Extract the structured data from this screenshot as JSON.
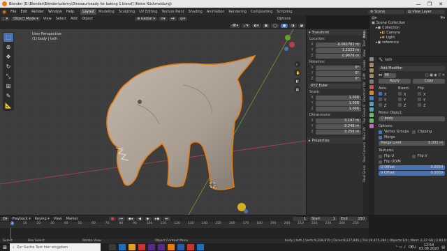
{
  "window": {
    "title": "Blender [E:\\Blender\\Blender\\udemy\\Dinosaur\\ready for baking 1.blend] (Keine Rückmeldung)",
    "controls": [
      "—",
      "❐",
      "✕"
    ]
  },
  "menubar": {
    "menus": [
      "File",
      "Edit",
      "Render",
      "Window",
      "Help"
    ],
    "workspaces": [
      "Layout",
      "Modeling",
      "Sculpting",
      "UV Editing",
      "Texture Paint",
      "Shading",
      "Animation",
      "Rendering",
      "Compositing",
      "Scripting"
    ],
    "active_workspace": "Layout",
    "scene_label": "Scene",
    "view_layer_label": "View Layer"
  },
  "viewport_header": {
    "mode": "Object Mode",
    "menus": [
      "View",
      "Select",
      "Add",
      "Object"
    ],
    "transform_orientation": "Global",
    "options_label": "Options"
  },
  "viewport": {
    "perspective_label": "User Perspective",
    "object_label": "(1) body | teth",
    "tools": [
      "select",
      "cursor",
      "move",
      "rotate",
      "scale",
      "transform",
      "annotate",
      "measure"
    ]
  },
  "npanel": {
    "tab_title": "Transform",
    "location_label": "Location:",
    "location": [
      {
        "axis": "X",
        "value": "-0.062781 m"
      },
      {
        "axis": "Y",
        "value": "1.2223 m"
      },
      {
        "axis": "Z",
        "value": "0.9676 m"
      }
    ],
    "rotation_label": "Rotation:",
    "rotation": [
      {
        "axis": "X",
        "value": "0°"
      },
      {
        "axis": "Y",
        "value": "0°"
      },
      {
        "axis": "Z",
        "value": "0°"
      }
    ],
    "rotation_mode": "XYZ Euler",
    "scale_label": "Scale:",
    "scale": [
      {
        "axis": "X",
        "value": "1.000"
      },
      {
        "axis": "Y",
        "value": "1.000"
      },
      {
        "axis": "Z",
        "value": "1.000"
      }
    ],
    "dimensions_label": "Dimensions:",
    "dimensions": [
      {
        "axis": "X",
        "value": "0.147 m"
      },
      {
        "axis": "Y",
        "value": "0.246 m"
      },
      {
        "axis": "Z",
        "value": "0.256 m"
      }
    ],
    "properties_label": "Properties"
  },
  "side_tabs": [
    "Item",
    "Tool",
    "View",
    "Create",
    "Edit",
    "Shortcut VUr",
    "The Grove 8",
    "Mio3 UV",
    "Real Camera",
    "Real Grass"
  ],
  "outliner": {
    "rows": [
      {
        "label": "Scene Collection",
        "color": "#bbbbbb"
      },
      {
        "label": "Collection",
        "color": "#bbbbbb"
      },
      {
        "label": "Camera",
        "color": "#d6a868"
      },
      {
        "label": "Light",
        "color": "#d6a868"
      },
      {
        "label": "reference",
        "color": "#bbbbbb"
      }
    ]
  },
  "properties": {
    "object_name": "teth",
    "add_modifier": "Add Modifier",
    "modifier_name": "Mi",
    "apply_label": "Apply",
    "copy_label": "Copy",
    "axis_label": "Axis:",
    "bisect_label": "Bisect:",
    "flip_label": "Flip",
    "axes": [
      {
        "name": "X",
        "axis_on": true,
        "bisect_on": false,
        "flip_on": false
      },
      {
        "name": "Y",
        "axis_on": false,
        "bisect_on": false,
        "flip_on": false
      },
      {
        "name": "Z",
        "axis_on": false,
        "bisect_on": false,
        "flip_on": false
      }
    ],
    "mirror_object_label": "Mirror Object:",
    "mirror_object": "body",
    "options_label": "Options:",
    "vertex_groups": "Vertex Groups",
    "clipping": "Clipping",
    "merge": "Merge",
    "merge_limit_label": "Merge Limit",
    "merge_limit": "0.001 m",
    "textures_label": "Textures:",
    "flip_u": "Flip U",
    "flip_v": "Flip V",
    "flip_udim": "Flip UDIM",
    "u_offset_label": "U Offset",
    "u_offset": "0.0000",
    "v_offset_label": "V Offset",
    "v_offset": "0.0000"
  },
  "timeline": {
    "menus": [
      "Playback",
      "Keying",
      "View",
      "Marker"
    ],
    "current_frame": "1",
    "start_label": "Start",
    "start": "1",
    "end_label": "End",
    "end": "250",
    "ticks": [
      "1",
      "10",
      "20",
      "30",
      "40",
      "50",
      "60",
      "70",
      "80",
      "90",
      "100",
      "110",
      "120",
      "130",
      "140",
      "150",
      "160",
      "170",
      "180",
      "190",
      "200",
      "210",
      "220",
      "230",
      "240",
      "250"
    ]
  },
  "statusbar": {
    "items": [
      "Select",
      "Box Select",
      "Rotate View",
      "Object Context Menu"
    ],
    "stats": "body | teth | Verts:9,238,870 | Faces:8,237,846 | Tris:18,475,284 | Objects:1/4 | Mem: 2.37 GB | 2.83.0"
  },
  "taskbar": {
    "search_placeholder": "Zur Suche Text hier eingeben",
    "language": "DEU",
    "time": "12:54",
    "date": "03.08.2020"
  },
  "colors": {
    "accent": "#4772b3",
    "selection": "#e87d0d",
    "viewport_bg": "#3d3d3d",
    "axis_red": "#b8414e",
    "axis_green": "#6a9e2e"
  }
}
